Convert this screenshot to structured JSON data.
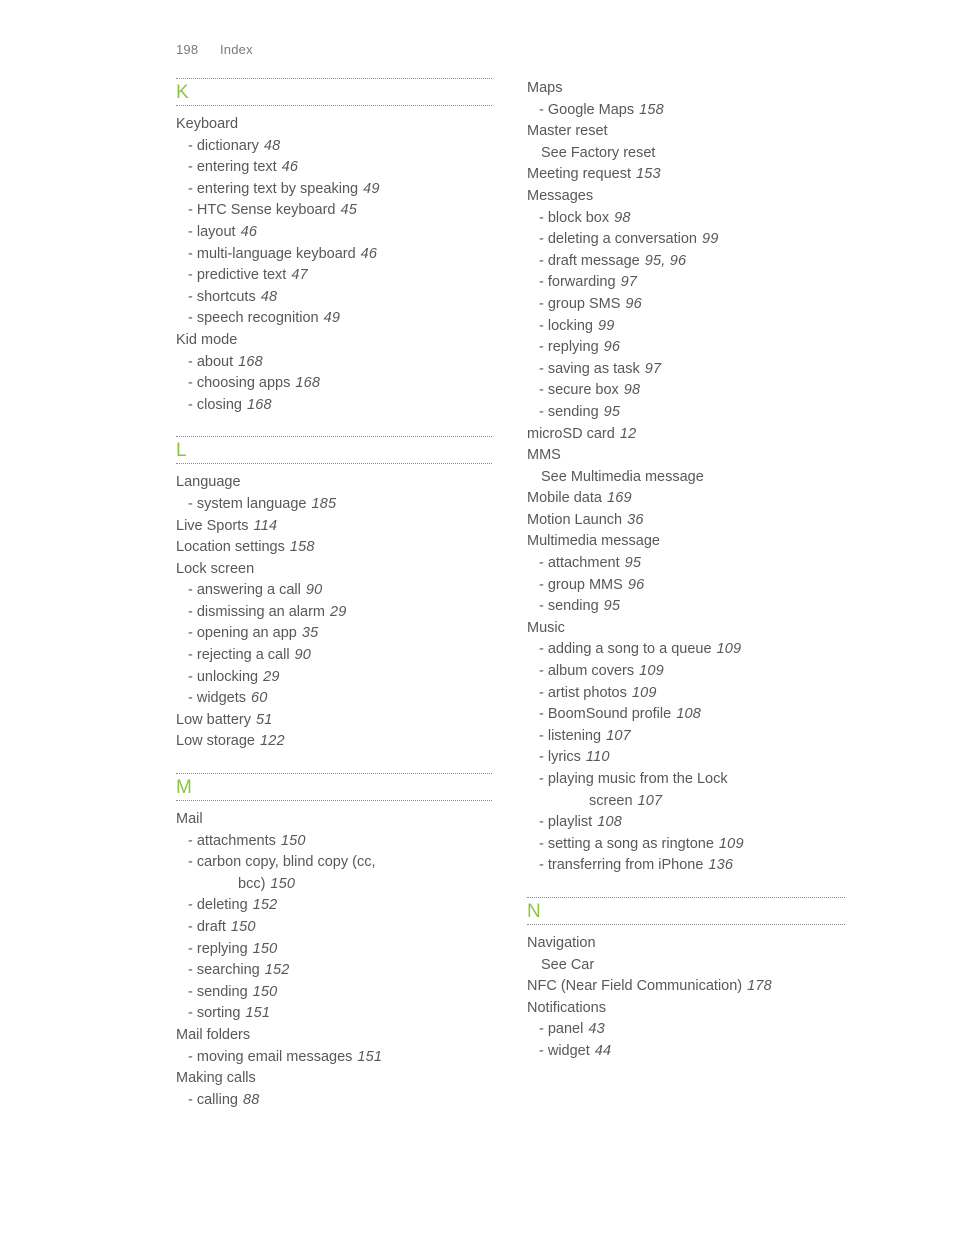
{
  "page": {
    "folio": "198",
    "section_name": "Index",
    "accent_color": "#8cc63f",
    "text_color": "#58585a"
  },
  "columns": [
    {
      "name": "left-column",
      "blocks": [
        {
          "type": "letter",
          "letter": "K"
        },
        {
          "type": "entries",
          "items": [
            {
              "level": 0,
              "label": "Keyboard",
              "pages": ""
            },
            {
              "level": 1,
              "label": "dictionary",
              "pages": "48"
            },
            {
              "level": 1,
              "label": "entering text",
              "pages": "46"
            },
            {
              "level": 1,
              "label": "entering text by speaking",
              "pages": "49"
            },
            {
              "level": 1,
              "label": "HTC Sense keyboard",
              "pages": "45"
            },
            {
              "level": 1,
              "label": "layout",
              "pages": "46"
            },
            {
              "level": 1,
              "label": "multi-language keyboard",
              "pages": "46"
            },
            {
              "level": 1,
              "label": "predictive text",
              "pages": "47"
            },
            {
              "level": 1,
              "label": "shortcuts",
              "pages": "48"
            },
            {
              "level": 1,
              "label": "speech recognition",
              "pages": "49"
            },
            {
              "level": 0,
              "label": "Kid mode",
              "pages": ""
            },
            {
              "level": 1,
              "label": "about",
              "pages": "168"
            },
            {
              "level": 1,
              "label": "choosing apps",
              "pages": "168"
            },
            {
              "level": 1,
              "label": "closing",
              "pages": "168"
            }
          ]
        },
        {
          "type": "letter",
          "letter": "L"
        },
        {
          "type": "entries",
          "items": [
            {
              "level": 0,
              "label": "Language",
              "pages": ""
            },
            {
              "level": 1,
              "label": "system language",
              "pages": "185"
            },
            {
              "level": 0,
              "label": "Live Sports",
              "pages": "114"
            },
            {
              "level": 0,
              "label": "Location settings",
              "pages": "158"
            },
            {
              "level": 0,
              "label": "Lock screen",
              "pages": ""
            },
            {
              "level": 1,
              "label": "answering a call",
              "pages": "90"
            },
            {
              "level": 1,
              "label": "dismissing an alarm",
              "pages": "29"
            },
            {
              "level": 1,
              "label": "opening an app",
              "pages": "35"
            },
            {
              "level": 1,
              "label": "rejecting a call",
              "pages": "90"
            },
            {
              "level": 1,
              "label": "unlocking",
              "pages": "29"
            },
            {
              "level": 1,
              "label": "widgets",
              "pages": "60"
            },
            {
              "level": 0,
              "label": "Low battery",
              "pages": "51"
            },
            {
              "level": 0,
              "label": "Low storage",
              "pages": "122"
            }
          ]
        },
        {
          "type": "letter",
          "letter": "M"
        },
        {
          "type": "entries",
          "items": [
            {
              "level": 0,
              "label": "Mail",
              "pages": ""
            },
            {
              "level": 1,
              "label": "attachments",
              "pages": "150"
            },
            {
              "level": 1,
              "label": "carbon copy, blind copy (cc,",
              "pages": ""
            },
            {
              "level": 3,
              "label": "bcc)",
              "pages": "150"
            },
            {
              "level": 1,
              "label": "deleting",
              "pages": "152"
            },
            {
              "level": 1,
              "label": "draft",
              "pages": "150"
            },
            {
              "level": 1,
              "label": "replying",
              "pages": "150"
            },
            {
              "level": 1,
              "label": "searching",
              "pages": "152"
            },
            {
              "level": 1,
              "label": "sending",
              "pages": "150"
            },
            {
              "level": 1,
              "label": "sorting",
              "pages": "151"
            },
            {
              "level": 0,
              "label": "Mail folders",
              "pages": ""
            },
            {
              "level": 1,
              "label": "moving email messages",
              "pages": "151"
            },
            {
              "level": 0,
              "label": "Making calls",
              "pages": ""
            },
            {
              "level": 1,
              "label": "calling",
              "pages": "88"
            }
          ]
        }
      ]
    },
    {
      "name": "right-column",
      "blocks": [
        {
          "type": "entries",
          "items": [
            {
              "level": 0,
              "label": "Maps",
              "pages": ""
            },
            {
              "level": 1,
              "label": "Google Maps",
              "pages": "158"
            },
            {
              "level": 0,
              "label": "Master reset",
              "pages": ""
            },
            {
              "level": 2,
              "label": "See Factory reset",
              "pages": ""
            },
            {
              "level": 0,
              "label": "Meeting request",
              "pages": "153"
            },
            {
              "level": 0,
              "label": "Messages",
              "pages": ""
            },
            {
              "level": 1,
              "label": "block box",
              "pages": "98"
            },
            {
              "level": 1,
              "label": "deleting a conversation",
              "pages": "99"
            },
            {
              "level": 1,
              "label": "draft message",
              "pages": "95, 96"
            },
            {
              "level": 1,
              "label": "forwarding",
              "pages": "97"
            },
            {
              "level": 1,
              "label": "group SMS",
              "pages": "96"
            },
            {
              "level": 1,
              "label": "locking",
              "pages": "99"
            },
            {
              "level": 1,
              "label": "replying",
              "pages": "96"
            },
            {
              "level": 1,
              "label": "saving as task",
              "pages": "97"
            },
            {
              "level": 1,
              "label": "secure box",
              "pages": "98"
            },
            {
              "level": 1,
              "label": "sending",
              "pages": "95"
            },
            {
              "level": 0,
              "label": "microSD card",
              "pages": "12"
            },
            {
              "level": 0,
              "label": "MMS",
              "pages": ""
            },
            {
              "level": 2,
              "label": "See Multimedia message",
              "pages": ""
            },
            {
              "level": 0,
              "label": "Mobile data",
              "pages": "169"
            },
            {
              "level": 0,
              "label": "Motion Launch",
              "pages": "36"
            },
            {
              "level": 0,
              "label": "Multimedia message",
              "pages": ""
            },
            {
              "level": 1,
              "label": "attachment",
              "pages": "95"
            },
            {
              "level": 1,
              "label": "group MMS",
              "pages": "96"
            },
            {
              "level": 1,
              "label": "sending",
              "pages": "95"
            },
            {
              "level": 0,
              "label": "Music",
              "pages": ""
            },
            {
              "level": 1,
              "label": "adding a song to a queue",
              "pages": "109"
            },
            {
              "level": 1,
              "label": "album covers",
              "pages": "109"
            },
            {
              "level": 1,
              "label": "artist photos",
              "pages": "109"
            },
            {
              "level": 1,
              "label": "BoomSound profile",
              "pages": "108"
            },
            {
              "level": 1,
              "label": "listening",
              "pages": "107"
            },
            {
              "level": 1,
              "label": "lyrics",
              "pages": "110"
            },
            {
              "level": 1,
              "label": "playing music from the Lock",
              "pages": ""
            },
            {
              "level": 3,
              "label": "screen",
              "pages": "107"
            },
            {
              "level": 1,
              "label": "playlist",
              "pages": "108"
            },
            {
              "level": 1,
              "label": "setting a song as ringtone",
              "pages": "109"
            },
            {
              "level": 1,
              "label": "transferring from iPhone",
              "pages": "136"
            }
          ]
        },
        {
          "type": "letter",
          "letter": "N"
        },
        {
          "type": "entries",
          "items": [
            {
              "level": 0,
              "label": "Navigation",
              "pages": ""
            },
            {
              "level": 2,
              "label": "See Car",
              "pages": ""
            },
            {
              "level": 0,
              "label": "NFC (Near Field Communication)",
              "pages": "178"
            },
            {
              "level": 0,
              "label": "Notifications",
              "pages": ""
            },
            {
              "level": 1,
              "label": "panel",
              "pages": "43"
            },
            {
              "level": 1,
              "label": "widget",
              "pages": "44"
            }
          ]
        }
      ]
    }
  ]
}
